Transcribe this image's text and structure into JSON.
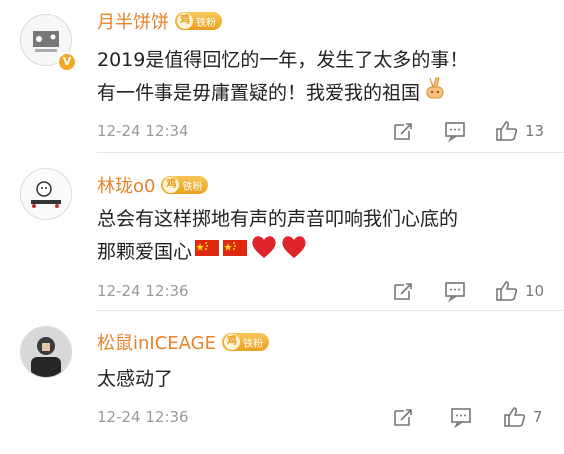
{
  "comments": [
    {
      "username": "月半饼饼",
      "verified_badge": "V",
      "fan_badge": {
        "crown": "鸡",
        "label": "铁粉"
      },
      "lines": [
        "2019是值得回忆的一年，发生了太多的事！",
        "有一件事是毋庸置疑的！我爱我的祖国"
      ],
      "emojis": [
        "victory-hand-emoji"
      ],
      "time": "12-24 12:34",
      "likes": "13"
    },
    {
      "username": "林珑o0",
      "fan_badge": {
        "crown": "鸡",
        "label": "铁粉"
      },
      "lines": [
        "总会有这样掷地有声的声音叩响我们心底的",
        "那颗爱国心"
      ],
      "emojis": [
        "china-flag-emoji",
        "china-flag-emoji",
        "red-heart-emoji",
        "red-heart-emoji"
      ],
      "time": "12-24 12:36",
      "likes": "10"
    },
    {
      "username": "松鼠inICEAGE",
      "fan_badge": {
        "crown": "鸡",
        "label": "铁粉"
      },
      "lines": [
        "太感动了"
      ],
      "time": "12-24 12:36",
      "likes": "7"
    }
  ],
  "icons": {
    "forward": "forward-icon",
    "comment": "comment-icon",
    "like": "thumbs-up-icon"
  },
  "colors": {
    "username": "#e8832b",
    "text": "#222222",
    "meta": "#999999",
    "fan_badge": "#e9a01d",
    "flag_red": "#de2910",
    "heart_red": "#e0242c"
  }
}
